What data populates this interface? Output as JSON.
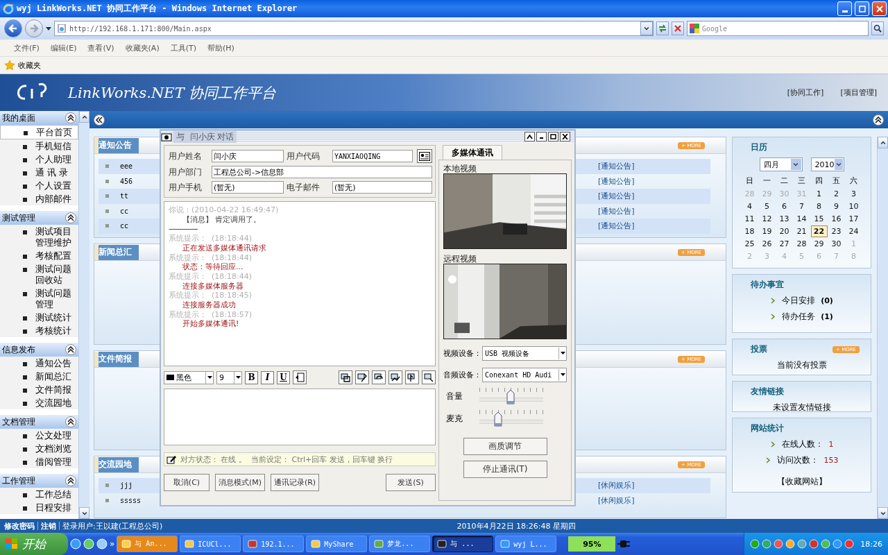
{
  "browser": {
    "title": "wyj LinkWorks.NET 协同工作平台 - Windows Internet Explorer",
    "address": "http://192.168.1.171:800/Main.aspx",
    "search_placeholder": "Google",
    "menu": [
      "文件(F)",
      "编辑(E)",
      "查看(V)",
      "收藏夹(A)",
      "工具(T)",
      "帮助(H)"
    ],
    "favorites": "收藏夹"
  },
  "banner": {
    "title": "LinkWorks.NET 协同工作平台",
    "links": [
      "[协同工作]",
      "[项目管理]"
    ]
  },
  "sidebar": {
    "groups": [
      {
        "title": "我的桌面",
        "items": [
          {
            "label": "平台首页",
            "selected": true
          },
          {
            "label": "手机短信",
            "selected": false
          },
          {
            "label": "个人助理",
            "selected": false
          },
          {
            "label": "通 讯 录",
            "selected": false
          },
          {
            "label": "个人设置",
            "selected": false
          },
          {
            "label": "内部邮件",
            "selected": false
          }
        ]
      },
      {
        "title": "测试管理",
        "items": [
          {
            "label": "测试项目管理维护",
            "selected": false
          },
          {
            "label": "考核配置",
            "selected": false
          },
          {
            "label": "测试问题回收站",
            "selected": false
          },
          {
            "label": "测试问题管理",
            "selected": false
          },
          {
            "label": "测试统计",
            "selected": false
          },
          {
            "label": "考核统计",
            "selected": false
          }
        ]
      },
      {
        "title": "信息发布",
        "items": [
          {
            "label": "通知公告",
            "selected": false
          },
          {
            "label": "新闻总汇",
            "selected": false
          },
          {
            "label": "文件简报",
            "selected": false
          },
          {
            "label": "交流园地",
            "selected": false
          }
        ]
      },
      {
        "title": "文档管理",
        "items": [
          {
            "label": "公文处理",
            "selected": false
          },
          {
            "label": "文档浏览",
            "selected": false
          },
          {
            "label": "借阅管理",
            "selected": false
          }
        ]
      },
      {
        "title": "工作管理",
        "items": [
          {
            "label": "工作总结",
            "selected": false
          },
          {
            "label": "日程安排",
            "selected": false
          }
        ]
      }
    ]
  },
  "panels": [
    {
      "title": "通知公告",
      "more": "+ MORE",
      "rows": [
        {
          "title": "eee",
          "tag": "[通知公告]"
        },
        {
          "title": "456",
          "tag": "[通知公告]"
        },
        {
          "title": "tt",
          "tag": "[通知公告]"
        },
        {
          "title": "cc",
          "tag": "[通知公告]"
        },
        {
          "title": "cc",
          "tag": "[通知公告]"
        }
      ]
    },
    {
      "title": "新闻总汇",
      "more": "+ MORE"
    },
    {
      "title": "文件简报",
      "more": "+ MORE"
    },
    {
      "title": "交流园地",
      "more": "+ MORE",
      "rows": [
        {
          "title": "jjj",
          "tag": "[休闲娱乐]"
        },
        {
          "title": "sssss",
          "tag": "[休闲娱乐]"
        }
      ]
    }
  ],
  "calendar": {
    "title": "日历",
    "month": "四月",
    "year": "2010",
    "weekdays": [
      "日",
      "一",
      "二",
      "三",
      "四",
      "五",
      "六"
    ],
    "weeks": [
      [
        {
          "day": "28",
          "other_month": true,
          "selected": false
        },
        {
          "day": "29",
          "other_month": true,
          "selected": false
        },
        {
          "day": "30",
          "other_month": true,
          "selected": false
        },
        {
          "day": "31",
          "other_month": true,
          "selected": false
        },
        {
          "day": "1",
          "other_month": false,
          "selected": false
        },
        {
          "day": "2",
          "other_month": false,
          "selected": false
        },
        {
          "day": "3",
          "other_month": false,
          "selected": false
        }
      ],
      [
        {
          "day": "4",
          "other_month": false,
          "selected": false
        },
        {
          "day": "5",
          "other_month": false,
          "selected": false
        },
        {
          "day": "6",
          "other_month": false,
          "selected": false
        },
        {
          "day": "7",
          "other_month": false,
          "selected": false
        },
        {
          "day": "8",
          "other_month": false,
          "selected": false
        },
        {
          "day": "9",
          "other_month": false,
          "selected": false
        },
        {
          "day": "10",
          "other_month": false,
          "selected": false
        }
      ],
      [
        {
          "day": "11",
          "other_month": false,
          "selected": false
        },
        {
          "day": "12",
          "other_month": false,
          "selected": false
        },
        {
          "day": "13",
          "other_month": false,
          "selected": false
        },
        {
          "day": "14",
          "other_month": false,
          "selected": false
        },
        {
          "day": "15",
          "other_month": false,
          "selected": false
        },
        {
          "day": "16",
          "other_month": false,
          "selected": false
        },
        {
          "day": "17",
          "other_month": false,
          "selected": false
        }
      ],
      [
        {
          "day": "18",
          "other_month": false,
          "selected": false
        },
        {
          "day": "19",
          "other_month": false,
          "selected": false
        },
        {
          "day": "20",
          "other_month": false,
          "selected": false
        },
        {
          "day": "21",
          "other_month": false,
          "selected": false
        },
        {
          "day": "22",
          "other_month": false,
          "selected": true
        },
        {
          "day": "23",
          "other_month": false,
          "selected": false
        },
        {
          "day": "24",
          "other_month": false,
          "selected": false
        }
      ],
      [
        {
          "day": "25",
          "other_month": false,
          "selected": false
        },
        {
          "day": "26",
          "other_month": false,
          "selected": false
        },
        {
          "day": "27",
          "other_month": false,
          "selected": false
        },
        {
          "day": "28",
          "other_month": false,
          "selected": false
        },
        {
          "day": "29",
          "other_month": false,
          "selected": false
        },
        {
          "day": "30",
          "other_month": false,
          "selected": false
        },
        {
          "day": "1",
          "other_month": true,
          "selected": false
        }
      ],
      [
        {
          "day": "2",
          "other_month": true,
          "selected": false
        },
        {
          "day": "3",
          "other_month": true,
          "selected": false
        },
        {
          "day": "4",
          "other_month": true,
          "selected": false
        },
        {
          "day": "5",
          "other_month": true,
          "selected": false
        },
        {
          "day": "6",
          "other_month": true,
          "selected": false
        },
        {
          "day": "7",
          "other_month": true,
          "selected": false
        },
        {
          "day": "8",
          "other_month": true,
          "selected": false
        }
      ]
    ]
  },
  "todo": {
    "title": "待办事宜",
    "items": [
      {
        "label": "今日安排",
        "count": "(0)"
      },
      {
        "label": "待办任务",
        "count": "(1)"
      }
    ]
  },
  "vote": {
    "title": "投票",
    "more": "+ MORE",
    "text": "当前没有投票"
  },
  "links": {
    "title": "友情链接",
    "text": "未设置友情链接"
  },
  "stats": {
    "title": "网站统计",
    "items": [
      {
        "label": "在线人数：",
        "value": "1"
      },
      {
        "label": "访问次数：",
        "value": "153"
      }
    ],
    "bookmark": "【收藏网站】"
  },
  "dialog": {
    "title": "与  闫小庆 对话",
    "fields": [
      {
        "label": "用户姓名",
        "value": "闫小庆"
      },
      {
        "label": "用户代码",
        "value": "YANXIAOQING"
      },
      {
        "label": "用户部门",
        "value": "工程总公司->信息部"
      },
      {
        "label": "用户手机",
        "value": "(暂无)"
      },
      {
        "label": "电子邮件",
        "value": "(暂无)"
      }
    ],
    "log": [
      {
        "kind": "meta",
        "text": "你说：(2010-04-22 16:49:47)"
      },
      {
        "kind": "message",
        "text": "【消息】 肯定调用了。"
      },
      {
        "kind": "rule",
        "text": "--------------"
      },
      {
        "kind": "meta",
        "text": "系统提示：  (18:18:44)"
      },
      {
        "kind": "alert",
        "text": "正在发送多媒体通讯请求"
      },
      {
        "kind": "meta",
        "text": "系统提示：  (18:18:44)"
      },
      {
        "kind": "alert",
        "text": "状态：等待回应..."
      },
      {
        "kind": "meta",
        "text": "系统提示：  (18:18:44)"
      },
      {
        "kind": "alert",
        "text": "连接多媒体服务器"
      },
      {
        "kind": "meta",
        "text": "系统提示：  (18:18:45)"
      },
      {
        "kind": "alert",
        "text": "连接服务器成功"
      },
      {
        "kind": "meta",
        "text": "系统提示：  (18:18:57)"
      },
      {
        "kind": "alert",
        "text": "开始多媒体通讯!"
      }
    ],
    "color_name": "黑色",
    "size": "9",
    "format_buttons": [
      "B",
      "I",
      "U"
    ],
    "status": "对方状态： 在线 。  当前设定： Ctrl+回车 发送，回车键 换行",
    "buttons": [
      "取消(C)",
      "消息模式(M)",
      "通讯记录(R)"
    ],
    "send": "发送(S)",
    "tab": {
      "label": "多媒体通讯",
      "selected": true
    },
    "videos": [
      "本地视频",
      "远程视频"
    ],
    "devices": [
      {
        "label": "视频设备：",
        "value": "USB 视频设备"
      },
      {
        "label": "音频设备：",
        "value": "Conexant HD Audi"
      }
    ],
    "sliders": [
      {
        "label": "音量",
        "level": 0.49
      },
      {
        "label": "麦克",
        "level": 0.29
      }
    ],
    "media_buttons": [
      "画质调节",
      "停止通讯(T)"
    ]
  },
  "status_bar": {
    "links": [
      "修改密码",
      "注销"
    ],
    "user": "登录用户:王以建(工程总公司)",
    "datetime": "2010年4月22日 18:26:48 星期四"
  },
  "taskbar": {
    "start": "开始",
    "quick_more": "»",
    "tasks": [
      {
        "label": "与 An...",
        "selected": false,
        "flashing": true
      },
      {
        "label": "ICUCl...",
        "selected": false,
        "flashing": false
      },
      {
        "label": "192.1...",
        "selected": false,
        "flashing": false
      },
      {
        "label": "MyShare",
        "selected": false,
        "flashing": false
      },
      {
        "label": "梦龙...",
        "selected": false,
        "flashing": false
      },
      {
        "label": "与 ...",
        "selected": true,
        "flashing": false
      },
      {
        "label": "wyj L...",
        "selected": false,
        "flashing": false
      }
    ],
    "meter": "95%",
    "time": "18:26"
  }
}
